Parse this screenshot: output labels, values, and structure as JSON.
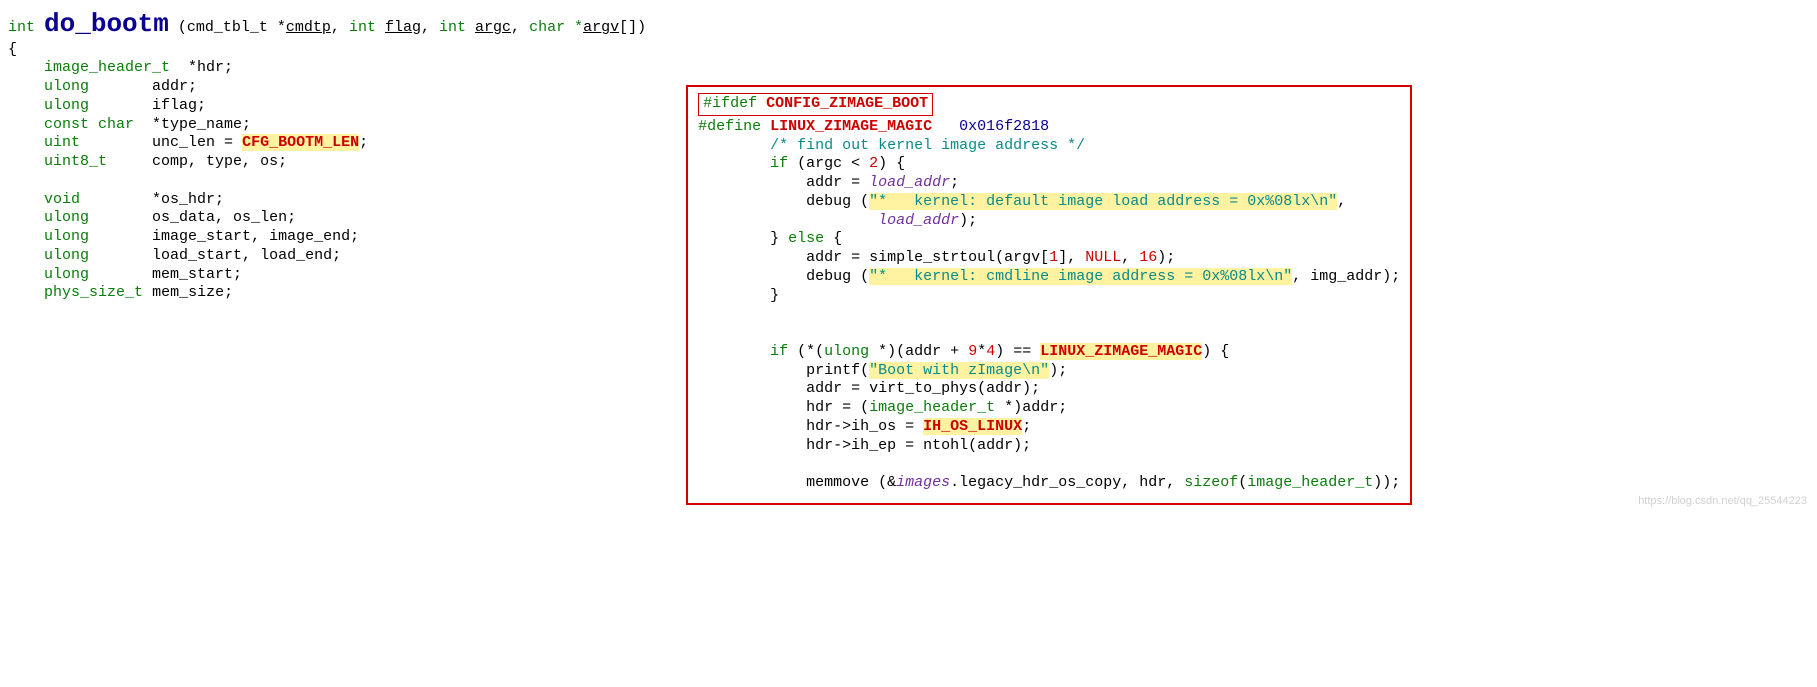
{
  "left": {
    "sig_type": "int",
    "sig_name": "do_bootm",
    "sig_p1_type": "cmd_tbl_t *",
    "sig_p1_name": "cmdtp",
    "sig_p2_type": "int",
    "sig_p2_name": "flag",
    "sig_p3_type": "int",
    "sig_p3_name": "argc",
    "sig_p4_type": "char *",
    "sig_p4_name": "argv",
    "sig_p4_suffix": "[])",
    "brace_open": "{",
    "l1_type": "image_header_t",
    "l1_rest": "  *hdr;",
    "l2_type": "ulong",
    "l2_name": "addr;",
    "l3_type": "ulong",
    "l3_name": "iflag;",
    "l4_type": "const char",
    "l4_name": "*type_name;",
    "l5_type": "uint",
    "l5_name": "unc_len = ",
    "l5_const": "CFG_BOOTM_LEN",
    "l5_semi": ";",
    "l6_type": "uint8_t",
    "l6_name": "comp, type, os;",
    "l7_type": "void",
    "l7_name": "*os_hdr;",
    "l8_type": "ulong",
    "l8_name": "os_data, os_len;",
    "l9_type": "ulong",
    "l9_name": "image_start, image_end;",
    "l10_type": "ulong",
    "l10_name": "load_start, load_end;",
    "l11_type": "ulong",
    "l11_name": "mem_start;",
    "l12_type": "phys_size_t",
    "l12_name": "mem_size;"
  },
  "right": {
    "ifdef_kw": "#ifdef",
    "ifdef_sym": " CONFIG_ZIMAGE_BOOT",
    "define_kw": "#define",
    "define_sym": " LINUX_ZIMAGE_MAGIC",
    "define_val": "0x016f2818",
    "comment1": "/* find out kernel image address */",
    "if_kw": "if",
    "cond1_open": " (argc < ",
    "cond1_num": "2",
    "cond1_close": ") {",
    "a_addr": "addr = ",
    "a_load_addr": "load_addr",
    "a_semi": ";",
    "dbg1a": "debug (",
    "dbg1_str": "\"*   kernel: default image load address = 0x%08lx\\n\"",
    "dbg1_comma": ",",
    "dbg1_arg": "load_addr",
    "dbg1_end": ");",
    "else_close": "} ",
    "else_kw": "else",
    "else_open": " {",
    "b_addr": "addr = simple_strtoul(argv[",
    "b_idx": "1",
    "b_mid": "], ",
    "b_null": "NULL",
    "b_after": ", ",
    "b_base": "16",
    "b_end": ");",
    "dbg2a": "debug (",
    "dbg2_str": "\"*   kernel: cmdline image address = 0x%08lx\\n\"",
    "dbg2_end": ", img_addr);",
    "close_brace": "}",
    "if2_kw": "if",
    "if2_open": " (*(",
    "if2_ulong": "ulong",
    "if2_mid": " *)(addr + ",
    "if2_n9": "9",
    "if2_star": "*",
    "if2_n4": "4",
    "if2_cmp": ") == ",
    "if2_magic": "LINUX_ZIMAGE_MAGIC",
    "if2_close": ") {",
    "pr_call": "printf(",
    "pr_str": "\"Boot with zImage\\n\"",
    "pr_end": ");",
    "v2p": "addr = virt_to_phys(addr);",
    "hdr_cast_a": "hdr = (",
    "hdr_cast_t": "image_header_t",
    "hdr_cast_b": " *)addr;",
    "hdr_os_a": "hdr->ih_os = ",
    "hdr_os_c": "IH_OS_LINUX",
    "hdr_os_b": ";",
    "hdr_ep": "hdr->ih_ep = ntohl(addr);",
    "mm_a": "memmove (&",
    "mm_it": "images",
    "mm_b": ".legacy_hdr_os_copy, hdr, ",
    "mm_sz": "sizeof",
    "mm_c": "(",
    "mm_t": "image_header_t",
    "mm_d": "));"
  },
  "watermark": "https://blog.csdn.net/qq_25544223"
}
